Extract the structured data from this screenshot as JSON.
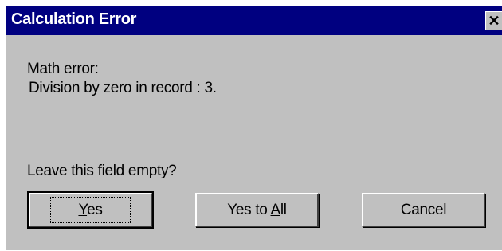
{
  "dialog": {
    "title": "Calculation Error",
    "close_glyph": "✕",
    "message_line1": "Math error:",
    "message_line2": "Division by zero in record : 3.",
    "question": "Leave this field empty?"
  },
  "buttons": {
    "yes_prefix": "",
    "yes_mnemonic": "Y",
    "yes_suffix": "es",
    "yes_to_all_prefix": "Yes to ",
    "yes_to_all_mnemonic": "A",
    "yes_to_all_suffix": "ll",
    "cancel": "Cancel"
  },
  "colors": {
    "titlebar": "#000080",
    "face": "#c0c0c0"
  }
}
